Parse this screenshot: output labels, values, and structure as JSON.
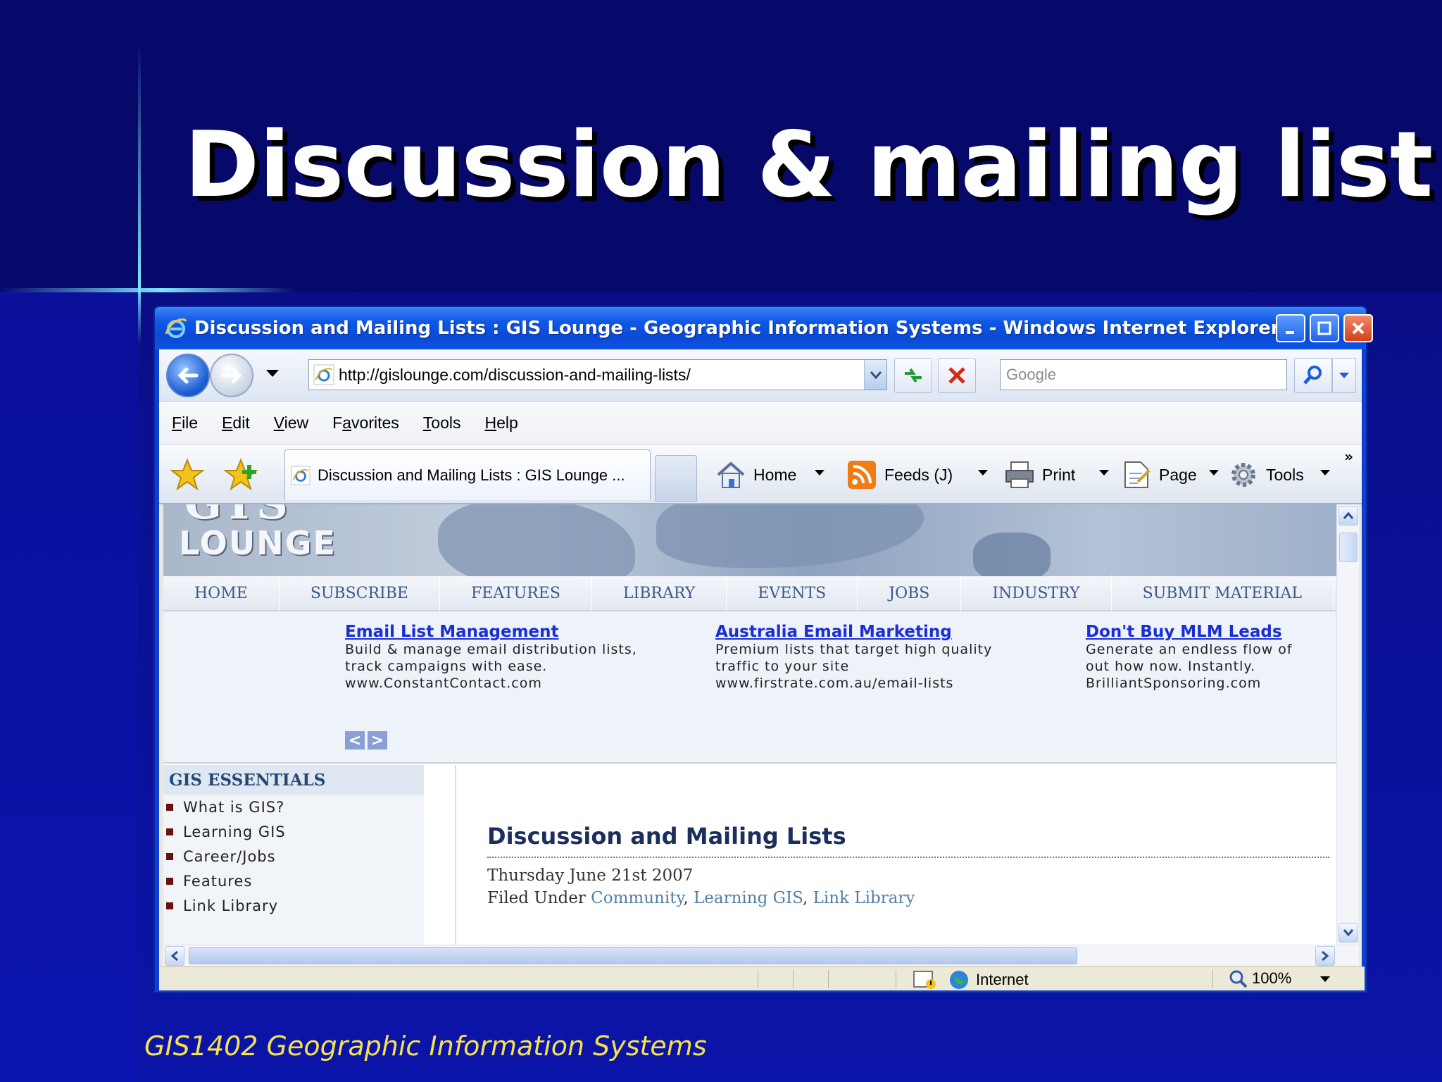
{
  "slide": {
    "title": "Discussion & mailing list",
    "footer": "GIS1402 Geographic Information Systems"
  },
  "window": {
    "title": "Discussion and Mailing Lists : GIS Lounge - Geographic Information Systems - Windows Internet Explorer"
  },
  "address_bar": {
    "url": "http://gislounge.com/discussion-and-mailing-lists/",
    "search_placeholder": "Google"
  },
  "menu": [
    "File",
    "Edit",
    "View",
    "Favorites",
    "Tools",
    "Help"
  ],
  "menu_mnemonics": [
    "F",
    "E",
    "V",
    "a",
    "T",
    "H"
  ],
  "tab": {
    "label": "Discussion and Mailing Lists : GIS Lounge ..."
  },
  "command_bar": {
    "home": "Home",
    "feeds": "Feeds (J)",
    "print": "Print",
    "page": "Page",
    "tools": "Tools",
    "more": "»"
  },
  "site": {
    "logo": "LOUNGE",
    "logo_top": "GIS",
    "nav": [
      "HOME",
      "SUBSCRIBE",
      "FEATURES",
      "LIBRARY",
      "EVENTS",
      "JOBS",
      "INDUSTRY",
      "SUBMIT MATERIAL"
    ],
    "ads": [
      {
        "title": "Email List Management",
        "lines": [
          "Build & manage email distribution lists,",
          "track campaigns with ease.",
          "www.ConstantContact.com"
        ]
      },
      {
        "title": "Australia Email Marketing",
        "lines": [
          "Premium lists that target high quality",
          "traffic to your site",
          "www.firstrate.com.au/email-lists"
        ]
      },
      {
        "title": "Don't Buy MLM Leads",
        "lines": [
          "Generate an endless flow of",
          "out how now. Instantly.",
          "BrilliantSponsoring.com"
        ]
      }
    ],
    "ad_nav": {
      "prev": "<",
      "next": ">"
    },
    "sidebar": {
      "heading": "GIS ESSENTIALS",
      "items": [
        "What is GIS?",
        "Learning GIS",
        "Career/Jobs",
        "Features",
        "Link Library"
      ]
    },
    "article": {
      "title": "Discussion and Mailing Lists",
      "date": "Thursday June 21st 2007",
      "filed_prefix": "Filed Under ",
      "categories": [
        "Community",
        "Learning GIS",
        "Link Library"
      ],
      "separator": ", "
    }
  },
  "status_bar": {
    "zone": "Internet",
    "zoom": "100%"
  }
}
